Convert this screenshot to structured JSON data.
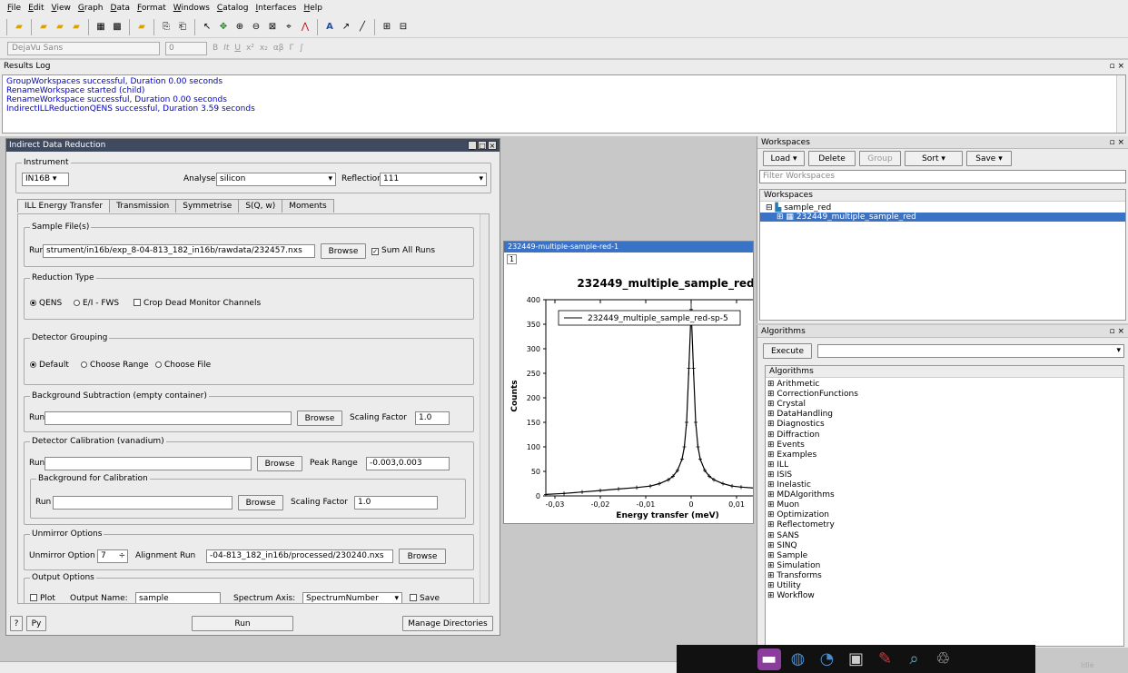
{
  "menu": [
    "File",
    "Edit",
    "View",
    "Graph",
    "Data",
    "Format",
    "Windows",
    "Catalog",
    "Interfaces",
    "Help"
  ],
  "fontbar": {
    "font": "DejaVu Sans",
    "size": "0"
  },
  "log": {
    "title": "Results Log",
    "lines": [
      "GroupWorkspaces successful, Duration 0.00 seconds",
      "RenameWorkspace started (child)",
      "RenameWorkspace successful, Duration 0.00 seconds",
      "IndirectILLReductionQENS successful, Duration 3.59 seconds"
    ]
  },
  "idr": {
    "title": "Indirect Data Reduction",
    "instrument_group": "Instrument",
    "instrument": "IN16B",
    "analyser_label": "Analyser",
    "analyser": "silicon",
    "reflection_label": "Reflection",
    "reflection": "111",
    "tabs": [
      "ILL Energy Transfer",
      "Transmission",
      "Symmetrise",
      "S(Q, w)",
      "Moments"
    ],
    "sample_group": "Sample File(s)",
    "run_label": "Run",
    "sample_run": "strument/in16b/exp_8-04-813_182_in16b/rawdata/232457.nxs",
    "browse": "Browse",
    "sum_all_runs": "Sum All Runs",
    "reduction_group": "Reduction Type",
    "qens": "QENS",
    "efws": "E/I - FWS",
    "crop_dead": "Crop Dead Monitor Channels",
    "grouping_group": "Detector Grouping",
    "grouping_default": "Default",
    "grouping_range": "Choose Range",
    "grouping_file": "Choose File",
    "bg_group": "Background Subtraction (empty container)",
    "scaling_label": "Scaling Factor",
    "bg_scaling": "1.0",
    "calib_group": "Detector Calibration (vanadium)",
    "peak_range_label": "Peak Range",
    "peak_range": "-0.003,0.003",
    "bg_calib_group": "Background for Calibration",
    "calib_scaling": "1.0",
    "unmirror_group": "Unmirror Options",
    "unmirror_label": "Unmirror Option",
    "unmirror_value": "7",
    "alignment_label": "Alignment Run",
    "alignment_run": "-04-813_182_in16b/processed/230240.nxs",
    "output_group": "Output Options",
    "plot": "Plot",
    "output_name_label": "Output Name:",
    "output_name": "sample",
    "spectrum_axis_label": "Spectrum Axis:",
    "spectrum_axis": "SpectrumNumber",
    "save": "Save",
    "help": "?",
    "py": "Py",
    "run": "Run",
    "manage": "Manage Directories"
  },
  "plot": {
    "window_title": "232449-multiple-sample-red-1",
    "layer": "1"
  },
  "chart_data": {
    "type": "line",
    "title": "232449_multiple_sample_red",
    "xlabel": "Energy transfer (meV)",
    "ylabel": "Counts",
    "xlim": [
      -0.032,
      0.014
    ],
    "ylim": [
      0,
      400
    ],
    "xticks": [
      "-0,03",
      "-0,02",
      "-0,01",
      "0",
      "0,01"
    ],
    "yticks": [
      "0",
      "50",
      "100",
      "150",
      "200",
      "250",
      "300",
      "350",
      "400"
    ],
    "legend_position": "top",
    "series": [
      {
        "name": "232449_multiple_sample_red-sp-5",
        "x": [
          -0.032,
          -0.028,
          -0.024,
          -0.02,
          -0.016,
          -0.012,
          -0.009,
          -0.007,
          -0.005,
          -0.004,
          -0.003,
          -0.002,
          -0.0015,
          -0.001,
          -0.0005,
          0,
          0.0005,
          0.001,
          0.0015,
          0.002,
          0.003,
          0.004,
          0.005,
          0.007,
          0.009,
          0.011,
          0.014
        ],
        "values": [
          3,
          5,
          8,
          11,
          14,
          17,
          20,
          25,
          33,
          40,
          52,
          75,
          100,
          150,
          260,
          380,
          260,
          150,
          100,
          75,
          52,
          40,
          33,
          25,
          20,
          18,
          16
        ]
      }
    ]
  },
  "workspaces": {
    "title": "Workspaces",
    "load": "Load",
    "delete": "Delete",
    "group": "Group",
    "sort": "Sort",
    "save": "Save",
    "filter_placeholder": "Filter Workspaces",
    "list_header": "Workspaces",
    "group_name": "sample_red",
    "item": "232449_multiple_sample_red"
  },
  "algorithms": {
    "title": "Algorithms",
    "execute": "Execute",
    "header": "Algorithms",
    "items": [
      "Arithmetic",
      "CorrectionFunctions",
      "Crystal",
      "DataHandling",
      "Diagnostics",
      "Diffraction",
      "Events",
      "Examples",
      "ILL",
      "ISIS",
      "Inelastic",
      "MDAlgorithms",
      "Muon",
      "Optimization",
      "Reflectometry",
      "SANS",
      "SINQ",
      "Sample",
      "Simulation",
      "Transforms",
      "Utility",
      "Workflow"
    ]
  },
  "status": "Idle",
  "colors": {
    "selection": "#3a72c6",
    "log_text": "#0000c8",
    "idr_title": "#404a5e"
  }
}
